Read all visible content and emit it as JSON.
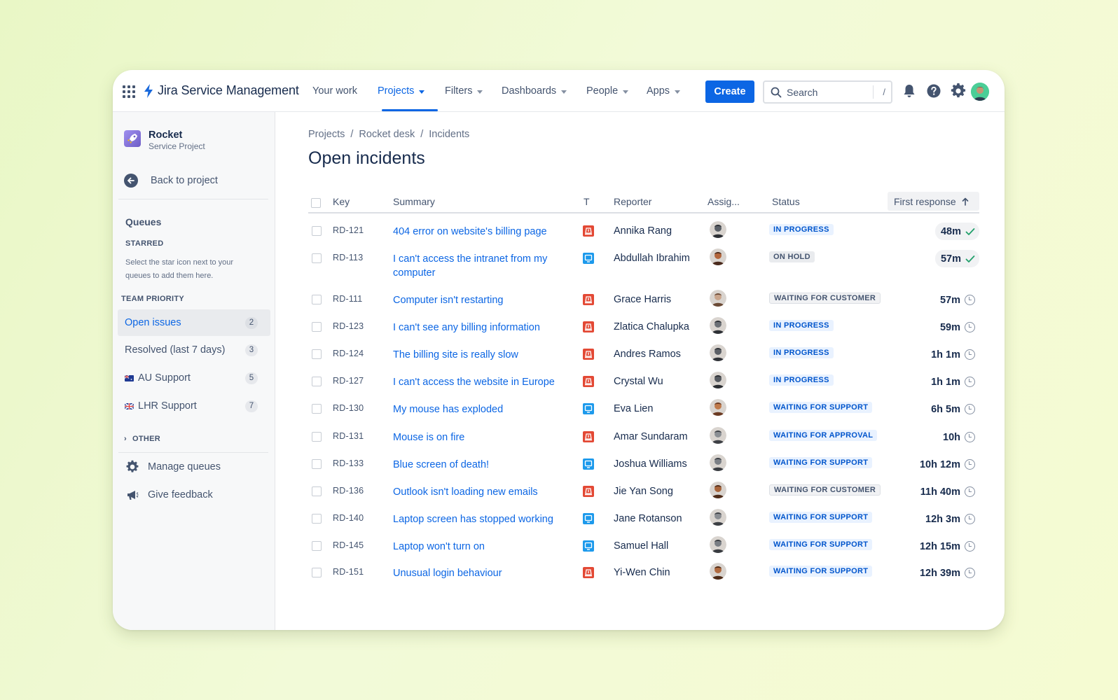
{
  "app": {
    "title": "Jira Service Management"
  },
  "nav": {
    "your_work": "Your work",
    "projects": "Projects",
    "filters": "Filters",
    "dashboards": "Dashboards",
    "people": "People",
    "apps": "Apps",
    "create": "Create",
    "search_placeholder": "Search",
    "search_shortcut": "/"
  },
  "sidebar": {
    "project_name": "Rocket",
    "project_type": "Service Project",
    "back_label": "Back to project",
    "queues_title": "Queues",
    "starred_label": "STARRED",
    "starred_hint": "Select the star icon next to your queues to add them here.",
    "team_priority_label": "TEAM PRIORITY",
    "queues": [
      {
        "label": "Open issues",
        "count": "2"
      },
      {
        "label": "Resolved (last 7 days)",
        "count": "3"
      },
      {
        "label": "AU Support",
        "count": "5"
      },
      {
        "label": "LHR Support",
        "count": "7"
      }
    ],
    "other_label": "OTHER",
    "manage_queues": "Manage queues",
    "give_feedback": "Give feedback"
  },
  "breadcrumb": [
    "Projects",
    "Rocket desk",
    "Incidents"
  ],
  "page_title": "Open incidents",
  "table": {
    "headers": {
      "key": "Key",
      "summary": "Summary",
      "type": "T",
      "reporter": "Reporter",
      "assignee": "Assig...",
      "status": "Status",
      "first_response": "First response"
    },
    "rows": [
      {
        "key": "RD-121",
        "summary": "404 error on website's billing page",
        "type": "incident",
        "reporter": "Annika Rang",
        "status": "IN PROGRESS",
        "response": "48m",
        "met": true
      },
      {
        "key": "RD-113",
        "summary": "I can't access the intranet from my computer",
        "type": "service",
        "reporter": "Abdullah Ibrahim",
        "status": "ON HOLD",
        "response": "57m",
        "met": true
      },
      {
        "key": "RD-111",
        "summary": "Computer isn't restarting",
        "type": "incident",
        "reporter": "Grace Harris",
        "status": "WAITING FOR CUSTOMER",
        "response": "57m",
        "met": false
      },
      {
        "key": "RD-123",
        "summary": "I can't see any billing information",
        "type": "incident",
        "reporter": "Zlatica Chalupka",
        "status": "IN PROGRESS",
        "response": "59m",
        "met": false
      },
      {
        "key": "RD-124",
        "summary": "The billing site is really slow",
        "type": "incident",
        "reporter": "Andres Ramos",
        "status": "IN PROGRESS",
        "response": "1h 1m",
        "met": false
      },
      {
        "key": "RD-127",
        "summary": "I can't access the website in Europe",
        "type": "incident",
        "reporter": "Crystal Wu",
        "status": "IN PROGRESS",
        "response": "1h 1m",
        "met": false
      },
      {
        "key": "RD-130",
        "summary": "My mouse has exploded",
        "type": "service",
        "reporter": "Eva Lien",
        "status": "WAITING FOR SUPPORT",
        "response": "6h 5m",
        "met": false
      },
      {
        "key": "RD-131",
        "summary": "Mouse is on fire",
        "type": "incident",
        "reporter": "Amar Sundaram",
        "status": "WAITING FOR APPROVAL",
        "response": "10h",
        "met": false
      },
      {
        "key": "RD-133",
        "summary": "Blue screen of death!",
        "type": "service",
        "reporter": "Joshua Williams",
        "status": "WAITING FOR SUPPORT",
        "response": "10h 12m",
        "met": false
      },
      {
        "key": "RD-136",
        "summary": "Outlook isn't loading new emails",
        "type": "incident",
        "reporter": "Jie Yan Song",
        "status": "WAITING FOR CUSTOMER",
        "response": "11h 40m",
        "met": false
      },
      {
        "key": "RD-140",
        "summary": "Laptop screen has stopped working",
        "type": "service",
        "reporter": "Jane Rotanson",
        "status": "WAITING FOR SUPPORT",
        "response": "12h 3m",
        "met": false
      },
      {
        "key": "RD-145",
        "summary": "Laptop won't turn on",
        "type": "service",
        "reporter": "Samuel Hall",
        "status": "WAITING FOR SUPPORT",
        "response": "12h 15m",
        "met": false
      },
      {
        "key": "RD-151",
        "summary": "Unusual login behaviour",
        "type": "incident",
        "reporter": "Yi-Wen Chin",
        "status": "WAITING FOR SUPPORT",
        "response": "12h 39m",
        "met": false
      }
    ]
  },
  "colors": {
    "primary": "#0c66e4",
    "incident": "#e34935",
    "service": "#1d9aec"
  }
}
